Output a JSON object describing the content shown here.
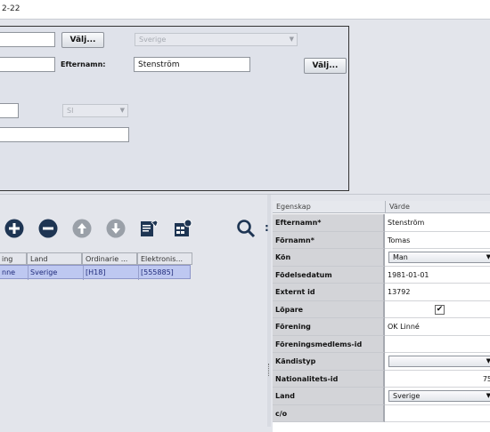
{
  "window": {
    "title": "2-22"
  },
  "form": {
    "valj_label_1": "Välj...",
    "country_disabled": "Sverige",
    "efternamn_label": "Efternamn:",
    "efternamn_value": "Stenström",
    "valj_label_2": "Välj...",
    "small_combo_disabled": "SI"
  },
  "toolbar": {
    "icons": [
      "add-icon",
      "remove-icon",
      "move-up-icon",
      "move-down-icon",
      "edit-icon",
      "table-settings-icon",
      "search-icon"
    ]
  },
  "table": {
    "columns": [
      "ing",
      "Land",
      "Ordinarie ...",
      "Elektronis..."
    ],
    "rows": [
      {
        "club": "nne",
        "land": "Sverige",
        "ordinarie": "[H18]",
        "elektronisk": "[555885]"
      }
    ]
  },
  "properties": {
    "header_key": "Egenskap",
    "header_value": "Värde",
    "rows": [
      {
        "key": "Efternamn*",
        "value": "Stenström",
        "type": "text"
      },
      {
        "key": "Förnamn*",
        "value": "Tomas",
        "type": "text"
      },
      {
        "key": "Kön",
        "value": "Man",
        "type": "combo"
      },
      {
        "key": "Födelsedatum",
        "value": "1981-01-01",
        "type": "text"
      },
      {
        "key": "Externt id",
        "value": "13792",
        "type": "text"
      },
      {
        "key": "Löpare",
        "value": "",
        "type": "checkbox",
        "checked": true
      },
      {
        "key": "Förening",
        "value": "OK Linné",
        "type": "text"
      },
      {
        "key": "Föreningsmedlems-id",
        "value": "",
        "type": "text"
      },
      {
        "key": "Kändistyp",
        "value": "",
        "type": "combo"
      },
      {
        "key": "Nationalitets-id",
        "value": "75",
        "type": "number"
      },
      {
        "key": "Land",
        "value": "Sverige",
        "type": "combo"
      },
      {
        "key": "c/o",
        "value": "",
        "type": "text"
      }
    ]
  },
  "colors": {
    "selection": "#bec8f1",
    "icon_dark": "#1e3553",
    "icon_disabled": "#9aa0a8"
  }
}
